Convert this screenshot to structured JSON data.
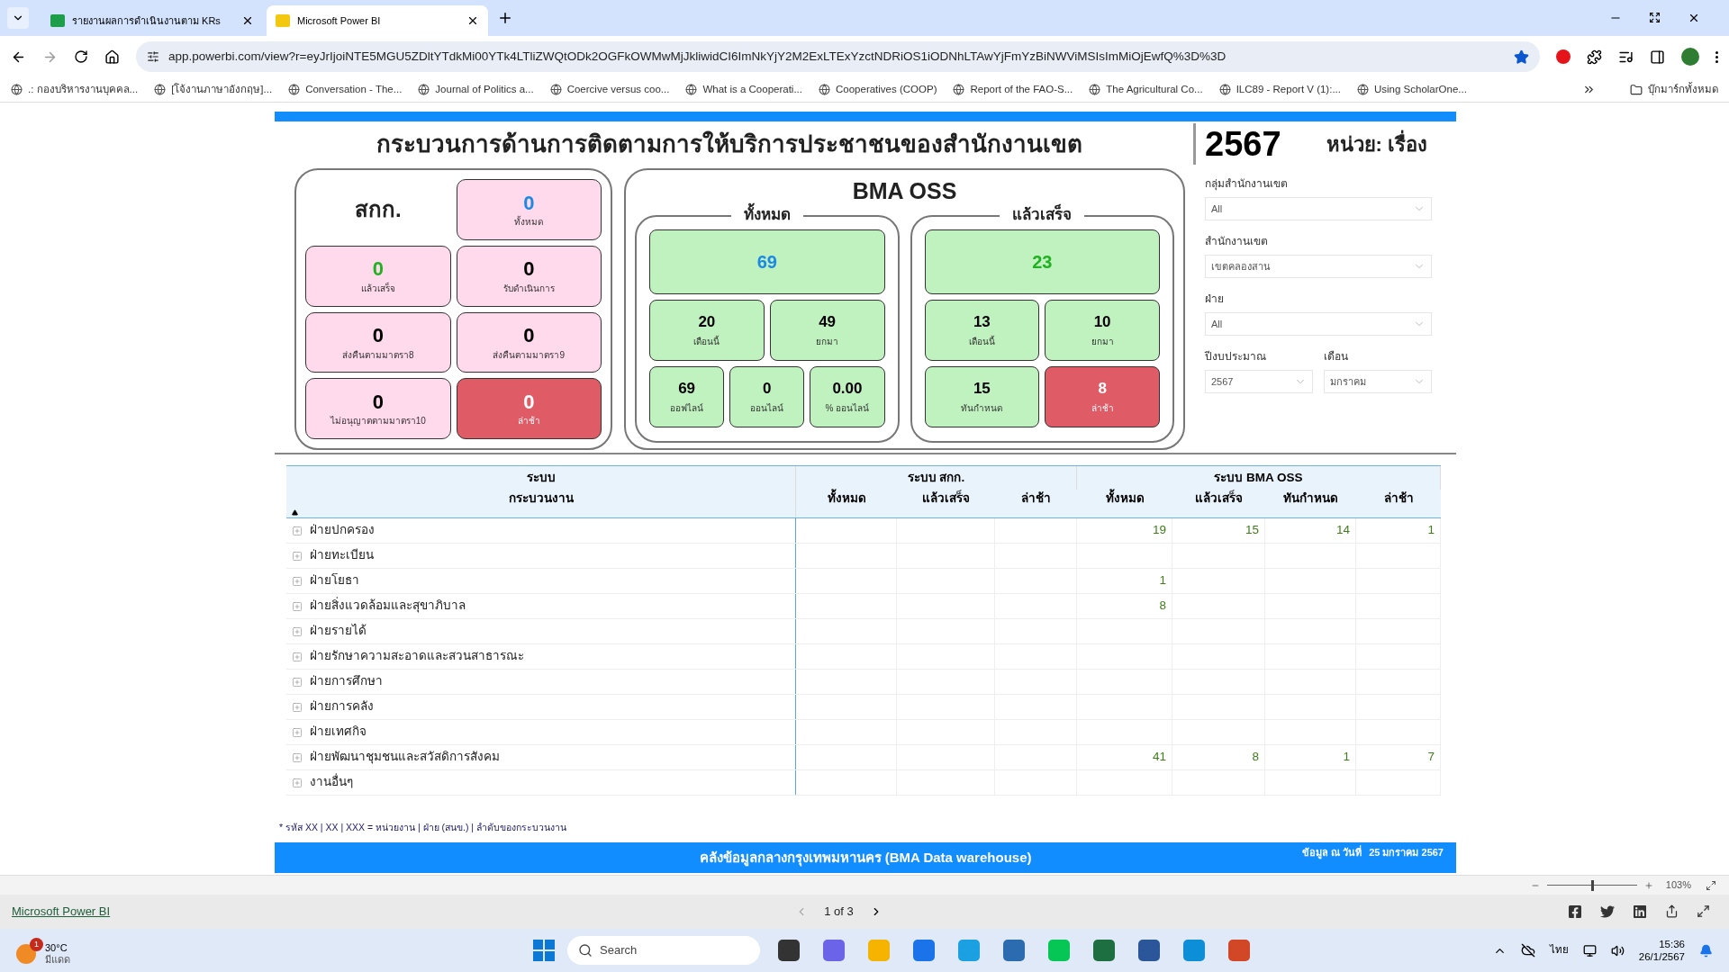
{
  "browser": {
    "tabs": [
      {
        "title": "รายงานผลการดำเนินงานตาม KRs",
        "selected": false
      },
      {
        "title": "Microsoft Power BI",
        "selected": true
      }
    ],
    "url": "app.powerbi.com/view?r=eyJrIjoiNTE5MGU5ZDltYTdkMi00YTk4LTliZWQtODk2OGFkOWMwMjJkliwidCI6ImNkYjY2M2ExLTExYzctNDRiOS1iODNhLTAwYjFmYzBiNWViMSIsImMiOjEwfQ%3D%3D",
    "bookmarks": [
      ".: กองบริหารงานบุคคล...",
      "[โจ้งานภาษาอังกฤษ]...",
      "Conversation - The...",
      "Journal of Politics a...",
      "Coercive versus coo...",
      "What is a Cooperati...",
      "Cooperatives (COOP)",
      "Report of the FAO-S...",
      "The Agricultural Co...",
      "ILC89 - Report V (1):...",
      "Using ScholarOne..."
    ],
    "bookmarks_folder": "บุ๊กมาร์กทั้งหมด"
  },
  "report": {
    "title": "กระบวนการด้านการติดตามการให้บริการประชาชนของสำนักงานเขต",
    "year": "2567",
    "unit": "หน่วย: เรื่อง",
    "skk": {
      "title": "สกก.",
      "cards": [
        {
          "value": "0",
          "label": "ทั้งหมด",
          "kind": "total"
        },
        {
          "value": "0",
          "label": "แล้วเสร็จ",
          "kind": "done"
        },
        {
          "value": "0",
          "label": "รับดำเนินการ",
          "kind": "plain"
        },
        {
          "value": "0",
          "label": "ส่งคืนตามมาตรา8",
          "kind": "plain"
        },
        {
          "value": "0",
          "label": "ส่งคืนตามมาตรา9",
          "kind": "plain"
        },
        {
          "value": "0",
          "label": "ไม่อนุญาตตามมาตรา10",
          "kind": "plain"
        },
        {
          "value": "0",
          "label": "ล่าช้า",
          "kind": "late"
        }
      ]
    },
    "oss": {
      "title": "BMA OSS",
      "groups": [
        {
          "title": "ทั้งหมด",
          "rows": [
            [
              {
                "value": "69",
                "kind": "total"
              }
            ],
            [
              {
                "value": "20",
                "label": "เดือนนี้",
                "kind": "plain"
              },
              {
                "value": "49",
                "label": "ยกมา",
                "kind": "plain"
              }
            ],
            [
              {
                "value": "69",
                "label": "ออฟไลน์",
                "kind": "plain"
              },
              {
                "value": "0",
                "label": "ออนไลน์",
                "kind": "plain"
              },
              {
                "value": "0.00",
                "label": "% ออนไลน์",
                "kind": "plain"
              }
            ]
          ]
        },
        {
          "title": "แล้วเสร็จ",
          "rows": [
            [
              {
                "value": "23",
                "kind": "done"
              }
            ],
            [
              {
                "value": "13",
                "label": "เดือนนี้",
                "kind": "plain"
              },
              {
                "value": "10",
                "label": "ยกมา",
                "kind": "plain"
              }
            ],
            [
              {
                "value": "15",
                "label": "ทันกำหนด",
                "kind": "plain"
              },
              {
                "value": "8",
                "label": "ล่าช้า",
                "kind": "late"
              }
            ]
          ]
        }
      ]
    },
    "filters": [
      {
        "label": "กลุ่มสำนักงานเขต",
        "value": "All"
      },
      {
        "label": "สำนักงานเขต",
        "value": "เขตคลองสาน"
      },
      {
        "label": "ฝ่าย",
        "value": "All"
      },
      {
        "label": "ปีงบประมาณ",
        "value": "2567"
      },
      {
        "label": "เดือน",
        "value": "มกราคม"
      }
    ],
    "table": {
      "system_label": "ระบบ",
      "process_label": "กระบวนงาน",
      "groups": [
        "ระบบ สกก.",
        "ระบบ BMA OSS"
      ],
      "columns": [
        "ทั้งหมด",
        "แล้วเสร็จ",
        "ล่าช้า",
        "ทั้งหมด",
        "แล้วเสร็จ",
        "ทันกำหนด",
        "ล่าช้า"
      ],
      "rows": [
        {
          "label": "ฝ่ายปกครอง",
          "oss_total": "19",
          "oss_done": "15",
          "oss_on_time": "14",
          "oss_late": "1"
        },
        {
          "label": "ฝ่ายทะเบียน"
        },
        {
          "label": "ฝ่ายโยธา",
          "oss_total": "1"
        },
        {
          "label": "ฝ่ายสิ่งแวดล้อมและสุขาภิบาล",
          "oss_total": "8"
        },
        {
          "label": "ฝ่ายรายได้"
        },
        {
          "label": "ฝ่ายรักษาความสะอาดและสวนสาธารณะ"
        },
        {
          "label": "ฝ่ายการศึกษา"
        },
        {
          "label": "ฝ่ายการคลัง"
        },
        {
          "label": "ฝ่ายเทศกิจ"
        },
        {
          "label": "ฝ่ายพัฒนาชุมชนและสวัสดิการสังคม",
          "oss_total": "41",
          "oss_done": "8",
          "oss_on_time": "1",
          "oss_late": "7"
        },
        {
          "label": "งานอื่นๆ"
        }
      ]
    },
    "footnote": "* รหัส XX | XX | XXX = หน่วยงาน | ฝ่าย (สนข.) | ลำดับของกระบวนงาน",
    "banner": {
      "title": "คลังข้อมูลกลางกรุงเทพมหานคร (BMA Data warehouse)",
      "date_label": "ข้อมูล ณ วันที่",
      "date": "25 มกราคม 2567"
    }
  },
  "viewer": {
    "zoom_slider": {
      "level": 0.5
    },
    "zoom": "103%",
    "link": "Microsoft Power BI",
    "page": "1 of 3"
  },
  "taskbar": {
    "weather_badge": "1",
    "temperature": "30°C",
    "condition": "มีแดด",
    "search": "Search",
    "language": "ไทย",
    "time": "15:36",
    "date": "26/1/2567"
  }
}
